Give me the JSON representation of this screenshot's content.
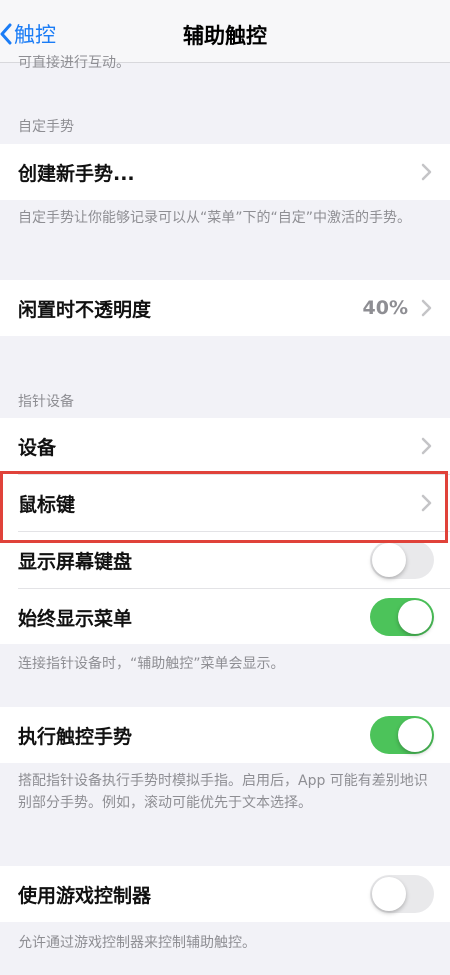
{
  "nav": {
    "back_label": "触控",
    "title": "辅助触控"
  },
  "top_cut_text": "可直接进行互动。",
  "custom_gestures": {
    "header": "自定手势",
    "create_label": "创建新手势...",
    "footer": "自定手势让你能够记录可以从“菜单”下的“自定”中激活的手势。"
  },
  "idle_opacity": {
    "label": "闲置时不透明度",
    "value": "40%"
  },
  "pointer_devices": {
    "header": "指针设备",
    "devices_label": "设备",
    "mouse_keys_label": "鼠标键",
    "show_keyboard_label": "显示屏幕键盘",
    "show_keyboard_on": false,
    "always_show_menu_label": "始终显示菜单",
    "always_show_menu_on": true,
    "footer": "连接指针设备时，“辅助触控”菜单会显示。"
  },
  "perform_gestures": {
    "label": "执行触控手势",
    "on": true,
    "footer": "搭配指针设备执行手势时模拟手指。启用后，App 可能有差别地识别部分手势。例如，滚动可能优先于文本选择。"
  },
  "game_controller": {
    "label": "使用游戏控制器",
    "on": false,
    "footer": "允许通过游戏控制器来控制辅助触控。"
  },
  "colors": {
    "accent": "#1a7cf6",
    "toggle_on": "#4cc35a",
    "highlight": "#e0423a"
  }
}
